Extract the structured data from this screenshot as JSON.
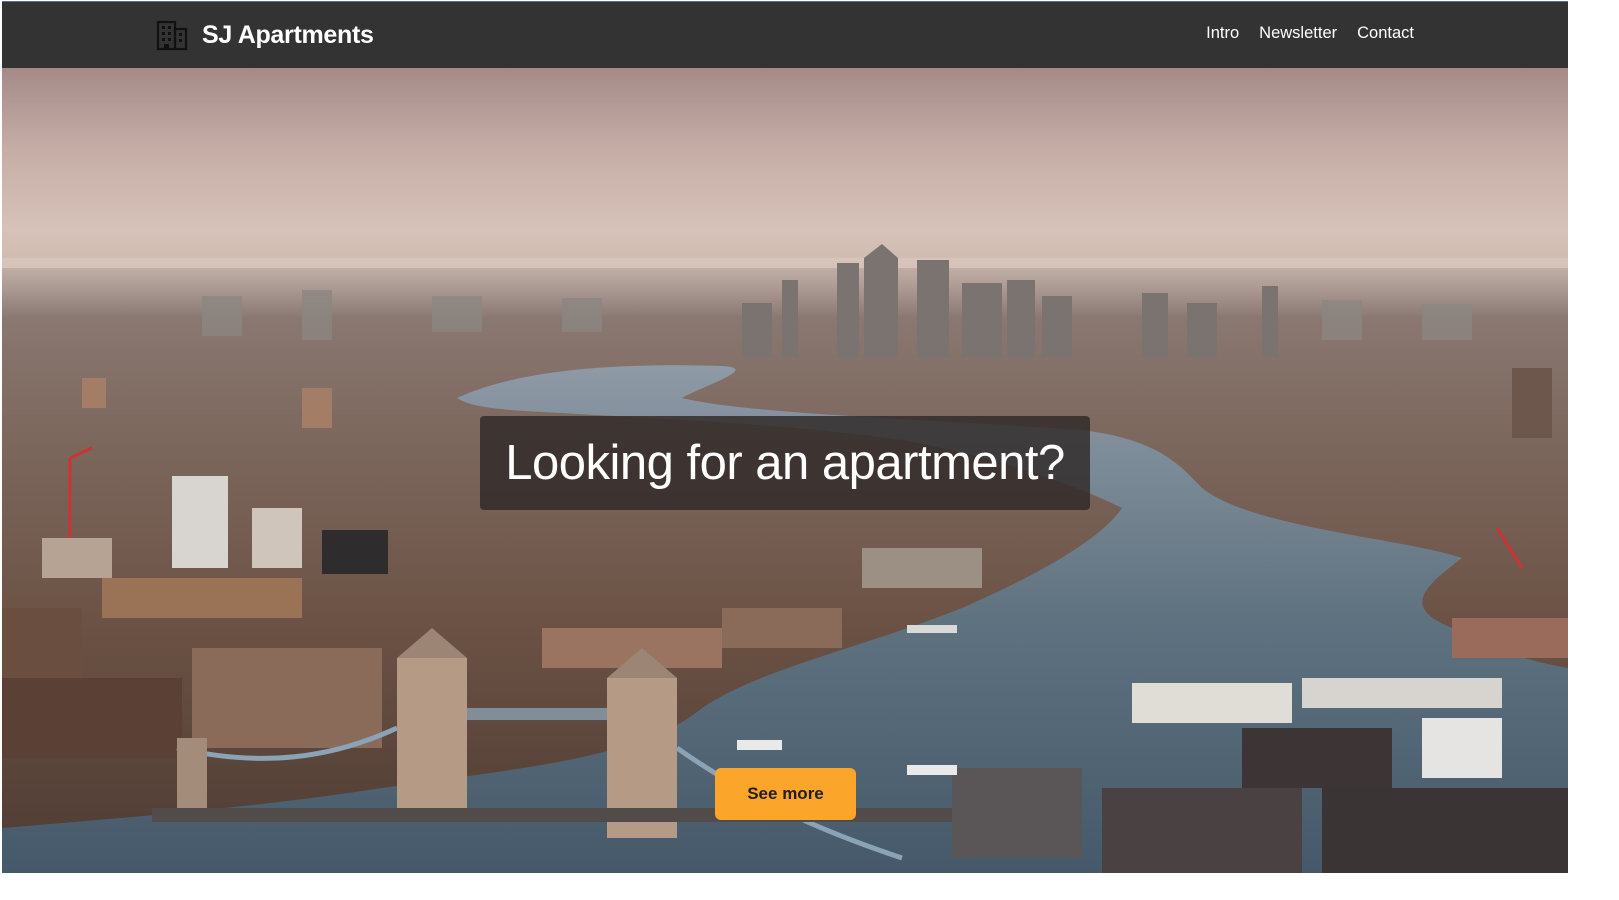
{
  "navbar": {
    "brand_icon": "building-icon",
    "brand_name": "SJ Apartments",
    "links": [
      {
        "label": "Intro"
      },
      {
        "label": "Newsletter"
      },
      {
        "label": "Contact"
      }
    ],
    "background": "#333333"
  },
  "hero": {
    "headline": "Looking for an apartment?",
    "cta_label": "See more",
    "cta_color": "#fca52b"
  }
}
